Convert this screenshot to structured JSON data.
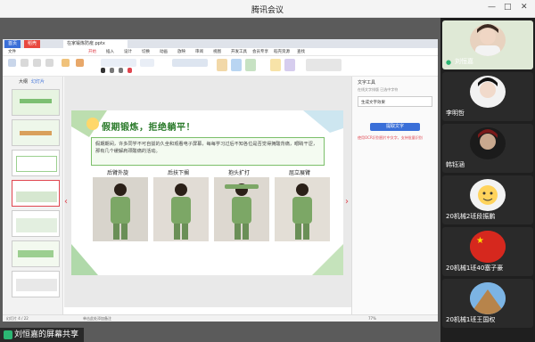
{
  "window": {
    "title": "腾讯会议",
    "minimize": "—",
    "maximize": "□",
    "close": "✕"
  },
  "wps": {
    "tabs": [
      {
        "label": "首页"
      },
      {
        "label": "稻壳"
      },
      {
        "label": "在家锻炼防疫.pptx"
      }
    ],
    "menu": [
      "文件",
      "开始",
      "插入",
      "设计",
      "切换",
      "动画",
      "放映",
      "审阅",
      "视图",
      "开发工具",
      "会员专享",
      "稻壳资源",
      "查找"
    ],
    "left_tabs": [
      "大纲",
      "幻灯片"
    ],
    "status_left": "幻灯片 4 / 22",
    "status_mid": "单击此处添加备注",
    "zoom": "77%",
    "right_pane": {
      "heading": "文字工具",
      "line1": "在线文字排版  已选中字符",
      "input": "生成文字效果",
      "button": "提取文字",
      "note": "使用OCR识别图片中文字，支持批量识别"
    }
  },
  "slide": {
    "title": "假期锻炼，拒绝躺平！",
    "body": "假期期间，许多同学不可自拔的久坐和观看电子屏幕，每每学习过后不知各位是否觉得拥酸背痛，眼睛干涩，那有几个缓解肩颈酸痛的活动。",
    "captions": [
      "后臂外旋",
      "后扶下搁",
      "抱头扩打",
      "屈立展臂"
    ]
  },
  "participants": [
    {
      "name": "刘恒嘉"
    },
    {
      "name": "李明哲"
    },
    {
      "name": "韩钰涵"
    },
    {
      "name": "20机械2班段振鹏"
    },
    {
      "name": "20机械1班40塞子豪"
    },
    {
      "name": "20机械1班王国权"
    }
  ],
  "share_banner": "刘恒嘉的屏幕共享"
}
